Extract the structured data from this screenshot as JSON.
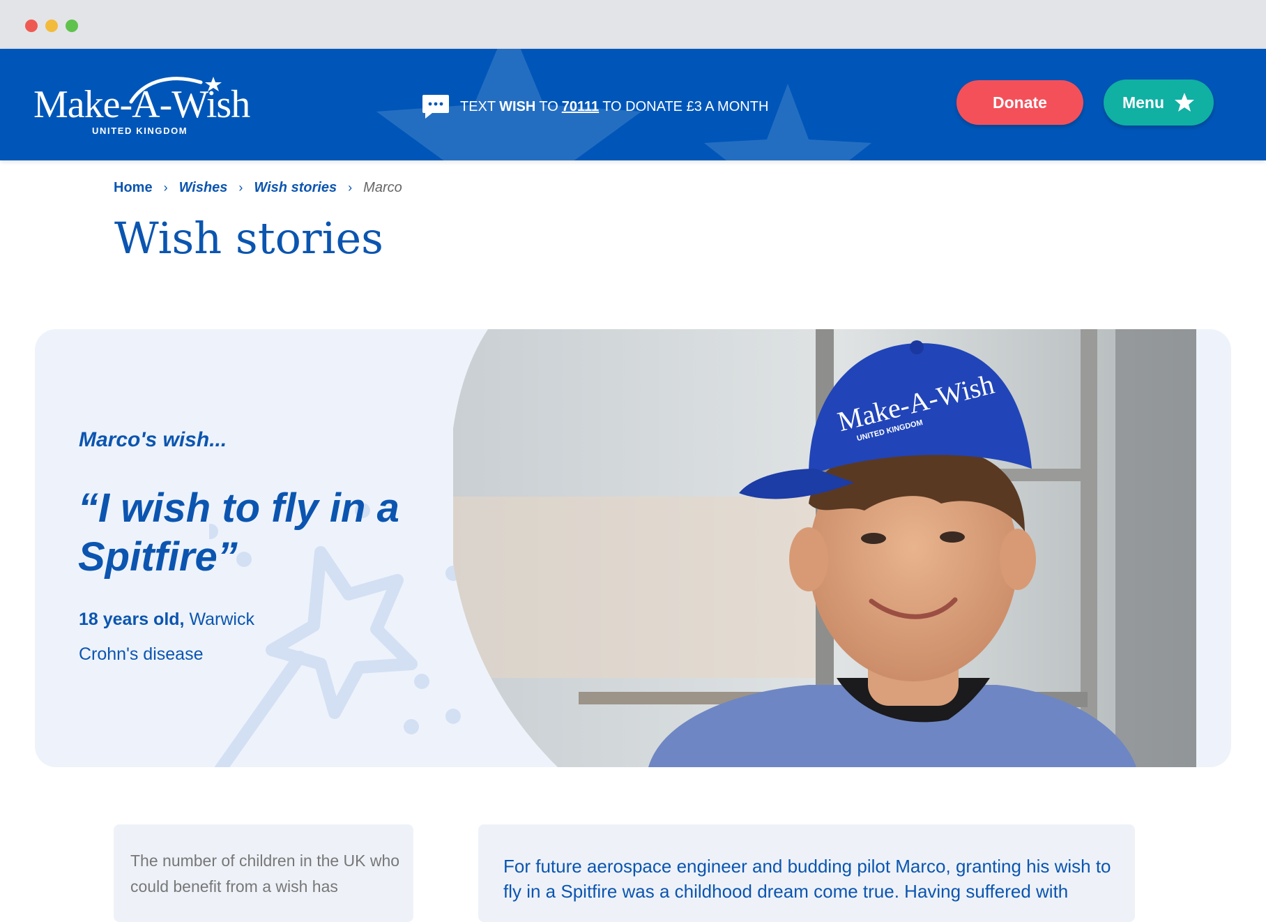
{
  "header": {
    "logo_text": "Make-A-Wish",
    "logo_sub": "UNITED KINGDOM",
    "sms": {
      "prefix": "TEXT",
      "keyword": "WISH",
      "to": "TO",
      "number": "70111",
      "suffix": "TO DONATE £3 A MONTH"
    },
    "donate_label": "Donate",
    "menu_label": "Menu"
  },
  "breadcrumb": {
    "items": [
      "Home",
      "Wishes",
      "Wish stories",
      "Marco"
    ]
  },
  "page_title": "Wish stories",
  "hero": {
    "label": "Marco's wish...",
    "quote": "“I wish to fly in a Spitfire”",
    "age": "18 years old,",
    "location": "Warwick",
    "condition": "Crohn's disease",
    "cap_text": "Make-A-Wish",
    "cap_sub": "UNITED KINGDOM"
  },
  "cards": {
    "left_text": "The number of children in the UK who could benefit from a wish has",
    "right_text": "For future aerospace engineer and budding pilot Marco, granting his wish to fly in a Spitfire was a childhood dream come true. Having suffered with"
  },
  "colors": {
    "header_blue": "#0056b8",
    "brand_blue": "#0b55b0",
    "donate_red": "#f4505a",
    "menu_teal": "#10b0a3",
    "card_bg": "#eef3fb"
  },
  "icons": [
    "sms-icon",
    "chevron-right-icon",
    "star-icon",
    "wand-star-icon"
  ]
}
